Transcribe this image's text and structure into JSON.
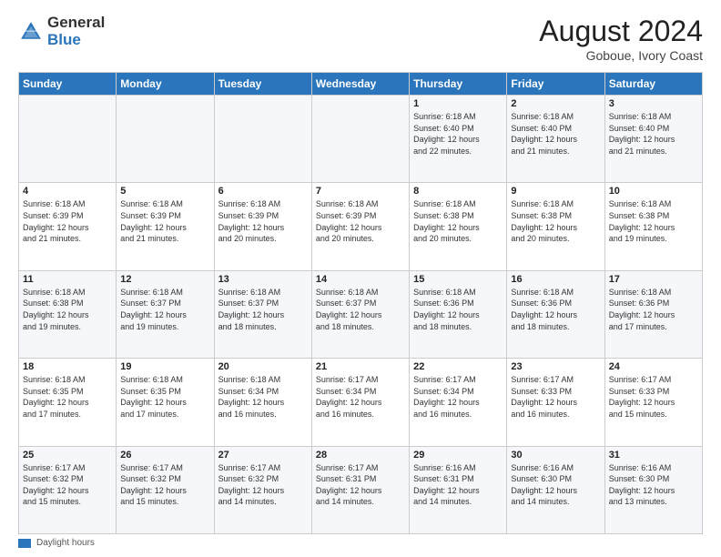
{
  "header": {
    "logo_line1": "General",
    "logo_line2": "Blue",
    "month": "August 2024",
    "location": "Goboue, Ivory Coast"
  },
  "days_of_week": [
    "Sunday",
    "Monday",
    "Tuesday",
    "Wednesday",
    "Thursday",
    "Friday",
    "Saturday"
  ],
  "weeks": [
    [
      {
        "num": "",
        "info": ""
      },
      {
        "num": "",
        "info": ""
      },
      {
        "num": "",
        "info": ""
      },
      {
        "num": "",
        "info": ""
      },
      {
        "num": "1",
        "info": "Sunrise: 6:18 AM\nSunset: 6:40 PM\nDaylight: 12 hours\nand 22 minutes."
      },
      {
        "num": "2",
        "info": "Sunrise: 6:18 AM\nSunset: 6:40 PM\nDaylight: 12 hours\nand 21 minutes."
      },
      {
        "num": "3",
        "info": "Sunrise: 6:18 AM\nSunset: 6:40 PM\nDaylight: 12 hours\nand 21 minutes."
      }
    ],
    [
      {
        "num": "4",
        "info": "Sunrise: 6:18 AM\nSunset: 6:39 PM\nDaylight: 12 hours\nand 21 minutes."
      },
      {
        "num": "5",
        "info": "Sunrise: 6:18 AM\nSunset: 6:39 PM\nDaylight: 12 hours\nand 21 minutes."
      },
      {
        "num": "6",
        "info": "Sunrise: 6:18 AM\nSunset: 6:39 PM\nDaylight: 12 hours\nand 20 minutes."
      },
      {
        "num": "7",
        "info": "Sunrise: 6:18 AM\nSunset: 6:39 PM\nDaylight: 12 hours\nand 20 minutes."
      },
      {
        "num": "8",
        "info": "Sunrise: 6:18 AM\nSunset: 6:38 PM\nDaylight: 12 hours\nand 20 minutes."
      },
      {
        "num": "9",
        "info": "Sunrise: 6:18 AM\nSunset: 6:38 PM\nDaylight: 12 hours\nand 20 minutes."
      },
      {
        "num": "10",
        "info": "Sunrise: 6:18 AM\nSunset: 6:38 PM\nDaylight: 12 hours\nand 19 minutes."
      }
    ],
    [
      {
        "num": "11",
        "info": "Sunrise: 6:18 AM\nSunset: 6:38 PM\nDaylight: 12 hours\nand 19 minutes."
      },
      {
        "num": "12",
        "info": "Sunrise: 6:18 AM\nSunset: 6:37 PM\nDaylight: 12 hours\nand 19 minutes."
      },
      {
        "num": "13",
        "info": "Sunrise: 6:18 AM\nSunset: 6:37 PM\nDaylight: 12 hours\nand 18 minutes."
      },
      {
        "num": "14",
        "info": "Sunrise: 6:18 AM\nSunset: 6:37 PM\nDaylight: 12 hours\nand 18 minutes."
      },
      {
        "num": "15",
        "info": "Sunrise: 6:18 AM\nSunset: 6:36 PM\nDaylight: 12 hours\nand 18 minutes."
      },
      {
        "num": "16",
        "info": "Sunrise: 6:18 AM\nSunset: 6:36 PM\nDaylight: 12 hours\nand 18 minutes."
      },
      {
        "num": "17",
        "info": "Sunrise: 6:18 AM\nSunset: 6:36 PM\nDaylight: 12 hours\nand 17 minutes."
      }
    ],
    [
      {
        "num": "18",
        "info": "Sunrise: 6:18 AM\nSunset: 6:35 PM\nDaylight: 12 hours\nand 17 minutes."
      },
      {
        "num": "19",
        "info": "Sunrise: 6:18 AM\nSunset: 6:35 PM\nDaylight: 12 hours\nand 17 minutes."
      },
      {
        "num": "20",
        "info": "Sunrise: 6:18 AM\nSunset: 6:34 PM\nDaylight: 12 hours\nand 16 minutes."
      },
      {
        "num": "21",
        "info": "Sunrise: 6:17 AM\nSunset: 6:34 PM\nDaylight: 12 hours\nand 16 minutes."
      },
      {
        "num": "22",
        "info": "Sunrise: 6:17 AM\nSunset: 6:34 PM\nDaylight: 12 hours\nand 16 minutes."
      },
      {
        "num": "23",
        "info": "Sunrise: 6:17 AM\nSunset: 6:33 PM\nDaylight: 12 hours\nand 16 minutes."
      },
      {
        "num": "24",
        "info": "Sunrise: 6:17 AM\nSunset: 6:33 PM\nDaylight: 12 hours\nand 15 minutes."
      }
    ],
    [
      {
        "num": "25",
        "info": "Sunrise: 6:17 AM\nSunset: 6:32 PM\nDaylight: 12 hours\nand 15 minutes."
      },
      {
        "num": "26",
        "info": "Sunrise: 6:17 AM\nSunset: 6:32 PM\nDaylight: 12 hours\nand 15 minutes."
      },
      {
        "num": "27",
        "info": "Sunrise: 6:17 AM\nSunset: 6:32 PM\nDaylight: 12 hours\nand 14 minutes."
      },
      {
        "num": "28",
        "info": "Sunrise: 6:17 AM\nSunset: 6:31 PM\nDaylight: 12 hours\nand 14 minutes."
      },
      {
        "num": "29",
        "info": "Sunrise: 6:16 AM\nSunset: 6:31 PM\nDaylight: 12 hours\nand 14 minutes."
      },
      {
        "num": "30",
        "info": "Sunrise: 6:16 AM\nSunset: 6:30 PM\nDaylight: 12 hours\nand 14 minutes."
      },
      {
        "num": "31",
        "info": "Sunrise: 6:16 AM\nSunset: 6:30 PM\nDaylight: 12 hours\nand 13 minutes."
      }
    ]
  ],
  "legend": {
    "label": "Daylight hours"
  }
}
